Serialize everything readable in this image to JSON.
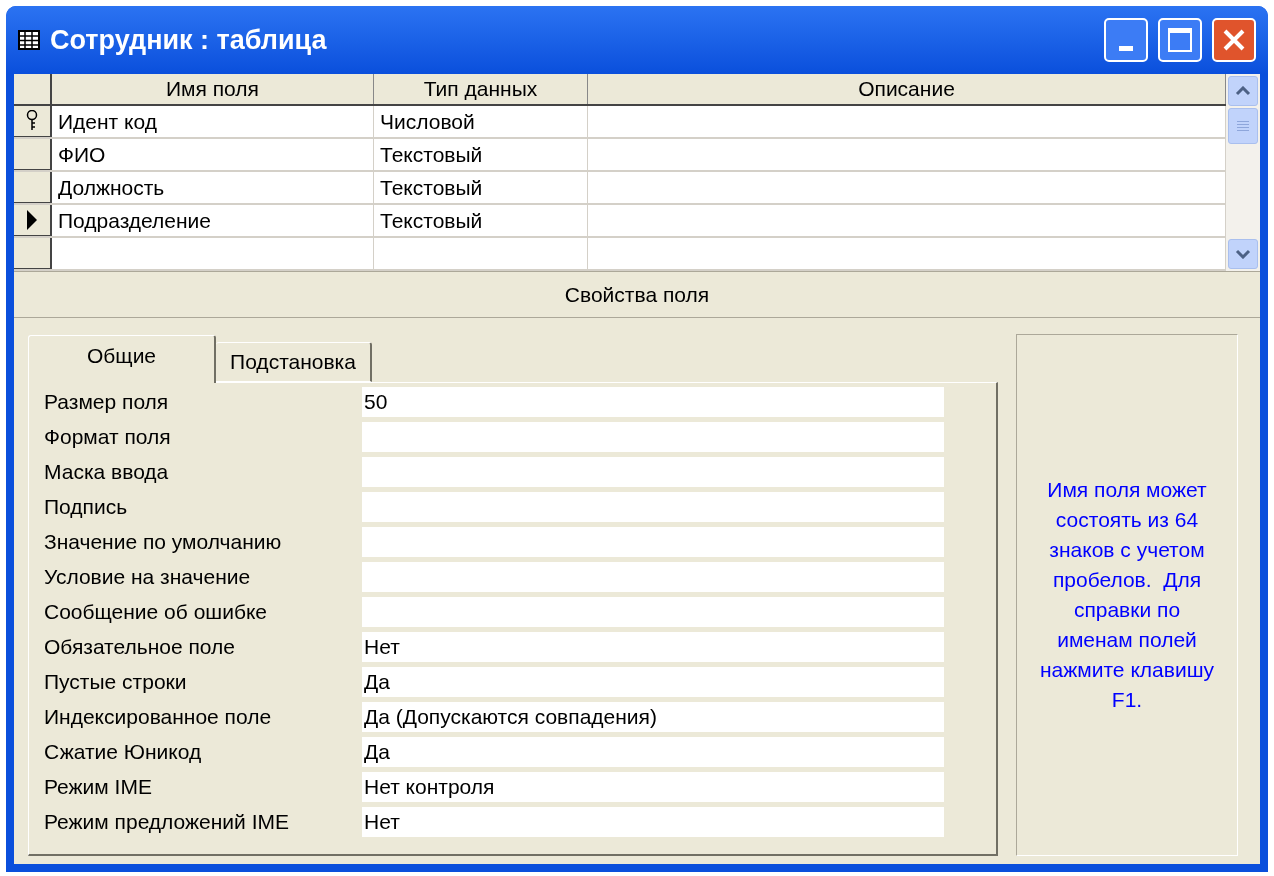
{
  "window": {
    "title": "Сотрудник : таблица"
  },
  "table": {
    "columns": [
      "Имя поля",
      "Тип данных",
      "Описание"
    ],
    "rows": [
      {
        "kind": "field",
        "field_name": "Идент код",
        "data_type": "Числовой",
        "primary_key": true,
        "selected": false
      },
      {
        "kind": "field",
        "field_name": "ФИО",
        "data_type": "Текстовый",
        "primary_key": false,
        "selected": false
      },
      {
        "kind": "field",
        "field_name": "Должность",
        "data_type": "Текстовый",
        "primary_key": false,
        "selected": false
      },
      {
        "kind": "field",
        "field_name": "Подразделение",
        "data_type": "Текстовый",
        "primary_key": false,
        "selected": true
      },
      {
        "kind": "new"
      }
    ]
  },
  "properties_header": "Свойства поля",
  "tabs": [
    {
      "label": "Общие",
      "selected": true
    },
    {
      "label": "Подстановка",
      "selected": false
    }
  ],
  "properties": [
    {
      "label": "Размер поля",
      "value": "50"
    },
    {
      "label": "Формат поля"
    },
    {
      "label": "Маска ввода"
    },
    {
      "label": "Подпись"
    },
    {
      "label": "Значение по умолчанию"
    },
    {
      "label": "Условие на значение"
    },
    {
      "label": "Сообщение об ошибке"
    },
    {
      "label": "Обязательное поле",
      "value": "Нет"
    },
    {
      "label": "Пустые строки",
      "value": "Да"
    },
    {
      "label": "Индексированное поле",
      "value": "Да (Допускаются совпадения)"
    },
    {
      "label": "Сжатие Юникод",
      "value": "Да"
    },
    {
      "label": "Режим IME",
      "value": "Нет контроля"
    },
    {
      "label": "Режим предложений IME",
      "value": "Нет"
    }
  ],
  "help_text": "Имя поля может состоять из 64 знаков с учетом пробелов.  Для справки по именам полей нажмите клавишу F1."
}
